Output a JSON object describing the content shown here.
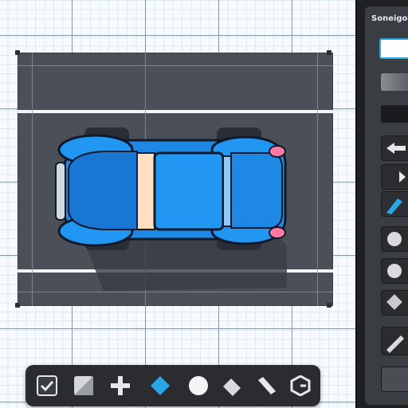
{
  "panel": {
    "title": "Soneigo"
  },
  "toolbar": {
    "tools": [
      {
        "name": "checkbox-tool"
      },
      {
        "name": "square-tool"
      },
      {
        "name": "plus-tool"
      },
      {
        "name": "diamond-tool"
      },
      {
        "name": "circle-tool"
      },
      {
        "name": "arrow-tool"
      },
      {
        "name": "line-tool"
      },
      {
        "name": "shape-tool"
      }
    ]
  },
  "colors": {
    "accent": "#2aa7e6",
    "road": "#4b4f57",
    "panel": "#3a3d42",
    "car_body": "#1e88e5"
  }
}
